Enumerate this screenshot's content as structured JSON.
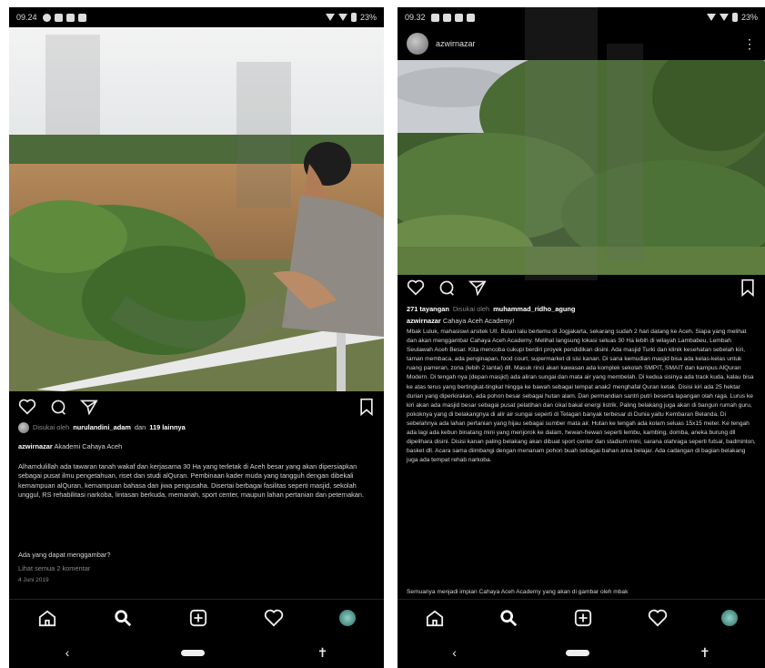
{
  "left": {
    "status": {
      "time": "09.24",
      "battery": "23%"
    },
    "likes": {
      "prefix": "Disukai oleh",
      "user": "nurulandini_adam",
      "middle": "dan",
      "count": "119 lainnya"
    },
    "caption": {
      "user": "azwirnazar",
      "text": "Akademi Cahaya Aceh"
    },
    "description": "Alhamdulillah ada tawaran tanah wakaf dan kerjasama 30 Ha yang terletak di Aceh besar yang akan dipersiapkan sebagai pusat ilmu pengetahuan, riset dan studi alQuran. Pembinaan kader muda yang tangguh dengan dibekali kemampuan alQuran, kemampuan bahasa dan jiwa pengusaha. Disertai berbagai fasilitas seperti masjid, sekolah unggul, RS rehabilitasi narkoba, lintasan berkuda, memanah, sport center, maupun lahan pertanian dan peternakan.",
    "question": "Ada yang dapat menggambar?",
    "view_comments": "Lihat semua 2 komentar",
    "date": "4 Juni 2019"
  },
  "right": {
    "status": {
      "time": "09.32",
      "battery": "23%"
    },
    "username": "azwirnazar",
    "views": {
      "count": "271 tayangan",
      "prefix": "Disukai oleh",
      "user": "muhammad_ridho_agung"
    },
    "caption": {
      "user": "azwirnazar",
      "text": "Cahaya Aceh Academy!"
    },
    "description": "Mbak Luluk, mahasiswi arsitek UII. Bulan lalu bertemu di Jogjakarta, sekarang sudah 2 hari datang ke Aceh. Siapa yang melihat dan akan menggambar Cahaya Aceh Academy. Melihat langsung lokasi seluas 30 Ha lebih di wilayah Lambabeu, Lembah Seulawah Aceh Besar. Kita mencoba cukupi berdiri proyek pendidikan disini. Ada masjid Turki dan klinik kesehatan sebelah kiri, taman membaca, ada penginapan, food court, supermarket di sisi kanan. Di sana kemudian masjid bisa ada kelas-kelas untuk ruang pameran, zona (lebih 2 lantai) dll. Masuk rinci akan kawasan ada komplek sekolah SMPIT, SMAIT dan kampus AlQuran Modern. Di tengah nya (depan masjid) ada aliran sungai dan mata air yang membelah. Di kedua sisinya ada track kuda, kalau bisa ke atas terus yang bertingkat-tingkat hingga ke bawah sebagai tempat anak2 menghafal Quran ketak. Disisi kiri ada 25 hektar durian yang diperkirakan, ada pohon besar sebagai hutan alam. Dan permandian santri putri beserta lapangan olah raga. Lurus ke kiri akan ada masjid besar sebagai pusat pelatihan dan cikal bakal energi listrik. Paling belakang juga akan di bangun rumah guru, pokoknya yang di belakangnya di alir air sungai seperti di Telagan banyak terbesar di Dunia yaitu Kembaran Belanda. Di sebelahnya ada lahan pertanian yang hijau sebagai sumber mata air. Hutan ke tengah ada kolam seluas 15x15 meter. Ke tengah ada lagi ada kebun binatang mini yang menjorok ke dalam, hewan-hewan seperti lembu, kambing, domba, aneka burung dll dipelihara disini. Disisi kanan paling belakang akan dibuat sport center dan stadium mini, sarana olahraga seperti futsal, badminton, basket dll. Acara sama diimbangi dengan menanam pohon buah sebagai bahan area belajar. Ada cadangan di bagian belakang juga ada tempat rehab narkoba.",
    "tail": "Semuanya menjadi impian Cahaya Aceh Academy yang akan di gambar oleh mbak"
  }
}
